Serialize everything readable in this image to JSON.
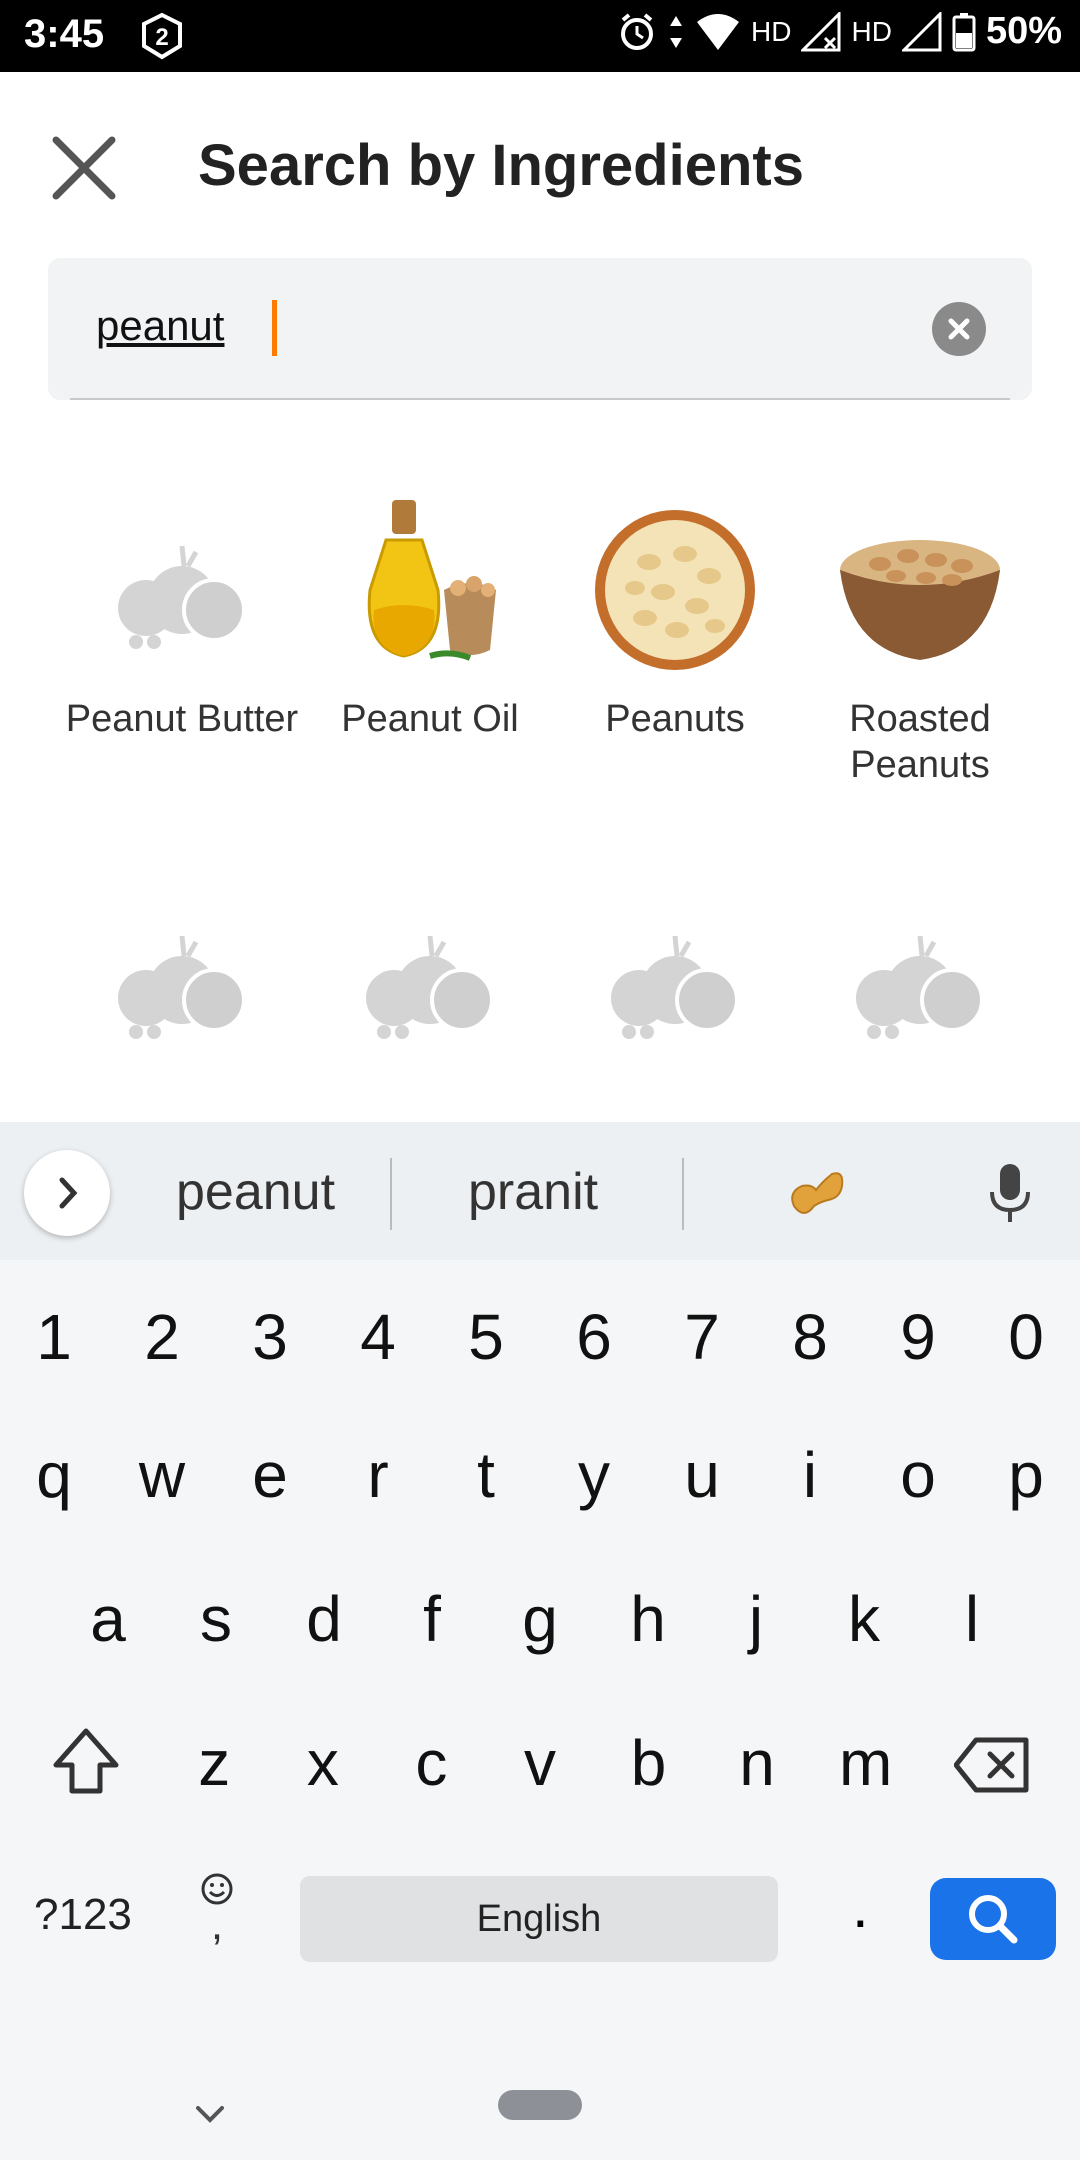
{
  "status_bar": {
    "time": "3:45",
    "notification_badge": "2",
    "hd1": "HD",
    "hd2": "HD",
    "battery": "50%"
  },
  "header": {
    "title": "Search by Ingredients"
  },
  "search": {
    "value": "peanut"
  },
  "results": [
    {
      "label": "Peanut Butter",
      "image": "placeholder-fruit-icon"
    },
    {
      "label": "Peanut Oil",
      "image": "peanut-oil-photo"
    },
    {
      "label": "Peanuts",
      "image": "peanuts-bowl-photo"
    },
    {
      "label": "Roasted Peanuts",
      "image": "roasted-peanuts-photo"
    },
    {
      "label": "",
      "image": "placeholder-fruit-icon"
    },
    {
      "label": "",
      "image": "placeholder-fruit-icon"
    },
    {
      "label": "",
      "image": "placeholder-fruit-icon"
    },
    {
      "label": "",
      "image": "placeholder-fruit-icon"
    }
  ],
  "keyboard": {
    "suggestions": [
      "peanut",
      "pranit"
    ],
    "emoji_suggestion": "peanut-emoji",
    "number_row": [
      "1",
      "2",
      "3",
      "4",
      "5",
      "6",
      "7",
      "8",
      "9",
      "0"
    ],
    "row1": [
      "q",
      "w",
      "e",
      "r",
      "t",
      "y",
      "u",
      "i",
      "o",
      "p"
    ],
    "row2": [
      "a",
      "s",
      "d",
      "f",
      "g",
      "h",
      "j",
      "k",
      "l"
    ],
    "row3": [
      "z",
      "x",
      "c",
      "v",
      "b",
      "n",
      "m"
    ],
    "sym_label": "?123",
    "comma": ",",
    "space_label": "English",
    "period": ".",
    "accent_color": "#1a73e8"
  }
}
